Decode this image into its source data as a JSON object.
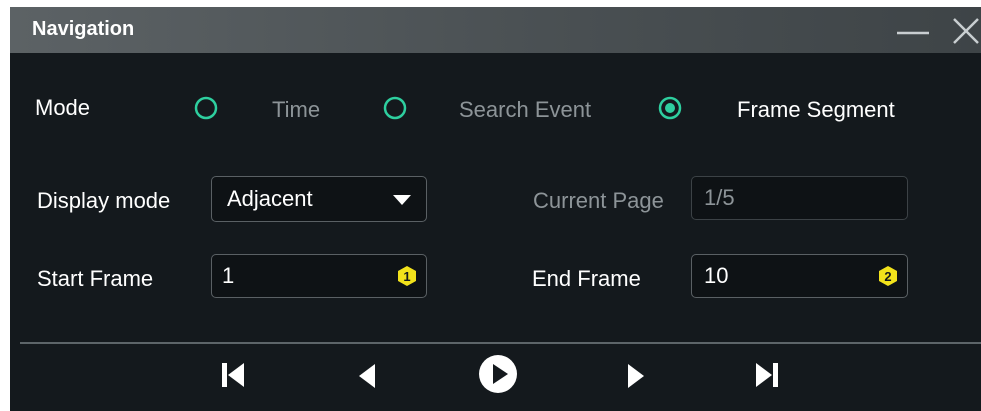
{
  "window": {
    "title": "Navigation",
    "minimize_icon": "minimize-icon",
    "close_icon": "close-icon"
  },
  "mode": {
    "label": "Mode",
    "options": [
      {
        "label": "Time",
        "selected": false
      },
      {
        "label": "Search Event",
        "selected": false
      },
      {
        "label": "Frame Segment",
        "selected": true
      }
    ],
    "accent_color": "#2ecf9f"
  },
  "display_mode": {
    "label": "Display mode",
    "value": "Adjacent"
  },
  "current_page": {
    "label": "Current Page",
    "value": "1/5"
  },
  "start_frame": {
    "label": "Start Frame",
    "value": "1",
    "badge": "1"
  },
  "end_frame": {
    "label": "End Frame",
    "value": "10",
    "badge": "2"
  },
  "badge_color": "#f2e21b",
  "controls": [
    "skip-to-start-icon",
    "previous-icon",
    "play-icon",
    "next-icon",
    "skip-to-end-icon"
  ]
}
